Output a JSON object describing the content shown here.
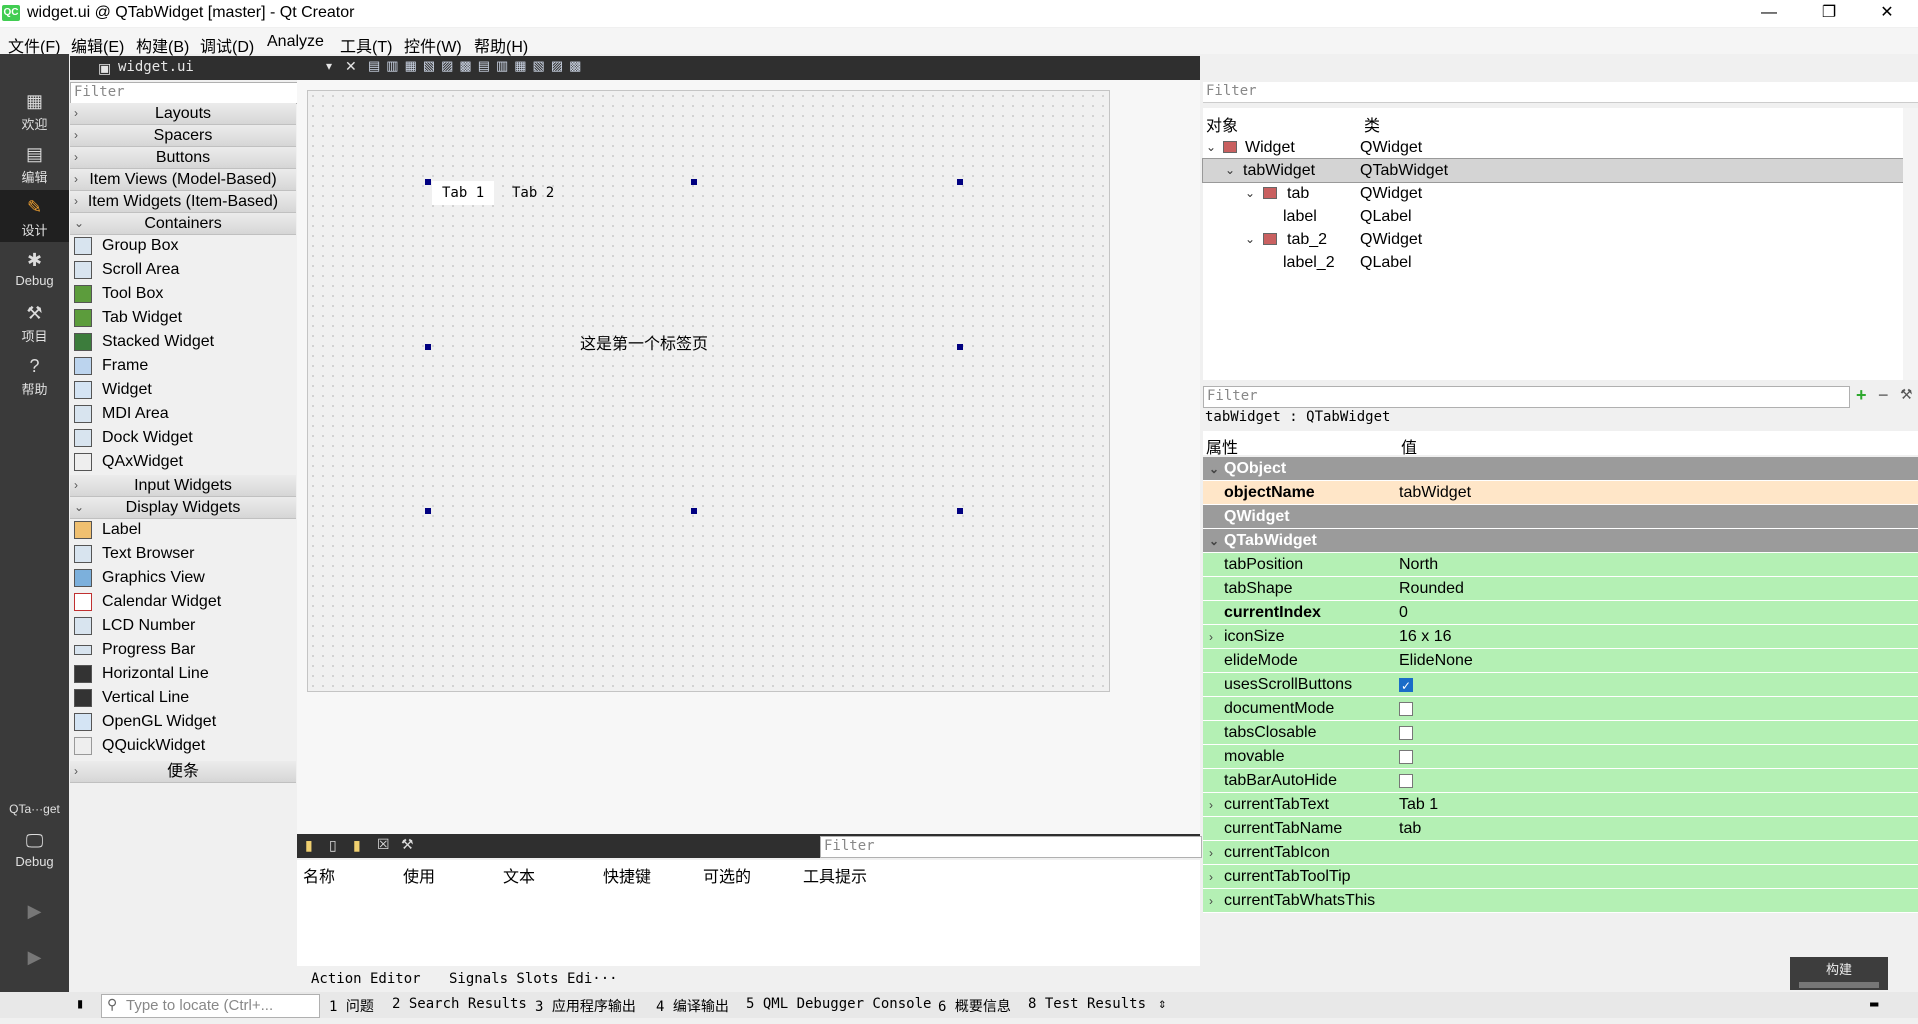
{
  "window": {
    "title": "widget.ui @ QTabWidget [master] - Qt Creator",
    "minimize": "—",
    "restore": "❐",
    "close": "✕"
  },
  "menu": [
    "文件(F)",
    "编辑(E)",
    "构建(B)",
    "调试(D)",
    "Analyze",
    "工具(T)",
    "控件(W)",
    "帮助(H)"
  ],
  "modes": [
    {
      "label": "欢迎",
      "icon": "grid-icon"
    },
    {
      "label": "编辑",
      "icon": "edit-doc-icon"
    },
    {
      "label": "设计",
      "icon": "pencil-icon"
    },
    {
      "label": "Debug",
      "icon": "bug-icon"
    },
    {
      "label": "项目",
      "icon": "wrench-icon"
    },
    {
      "label": "帮助",
      "icon": "help-icon"
    }
  ],
  "kit": {
    "label": "QTa···get",
    "mode": "Debug"
  },
  "editor": {
    "file_tab": "widget.ui"
  },
  "widget_box": {
    "filter_placeholder": "Filter",
    "categories_top": [
      "Layouts",
      "Spacers",
      "Buttons",
      "Item Views (Model-Based)",
      "Item Widgets (Item-Based)",
      "Containers"
    ],
    "containers": [
      "Group Box",
      "Scroll Area",
      "Tool Box",
      "Tab Widget",
      "Stacked Widget",
      "Frame",
      "Widget",
      "MDI Area",
      "Dock Widget",
      "QAxWidget"
    ],
    "mid_categories": [
      "Input Widgets",
      "Display Widgets"
    ],
    "display": [
      "Label",
      "Text Browser",
      "Graphics View",
      "Calendar Widget",
      "LCD Number",
      "Progress Bar",
      "Horizontal Line",
      "Vertical Line",
      "OpenGL Widget",
      "QQuickWidget"
    ],
    "last_category": "便条"
  },
  "form": {
    "tabs": [
      "Tab 1",
      "Tab 2"
    ],
    "label_text": "这是第一个标签页"
  },
  "action_editor": {
    "filter_placeholder": "Filter",
    "columns": [
      "名称",
      "使用",
      "文本",
      "快捷键",
      "可选的",
      "工具提示"
    ],
    "tabs": [
      "Action Editor",
      "Signals  Slots Edi···"
    ]
  },
  "object_inspector": {
    "filter_placeholder": "Filter",
    "col_object": "对象",
    "col_class": "类",
    "rows": [
      {
        "object": "Widget",
        "class": "QWidget"
      },
      {
        "object": "tabWidget",
        "class": "QTabWidget"
      },
      {
        "object": "tab",
        "class": "QWidget"
      },
      {
        "object": "label",
        "class": "QLabel"
      },
      {
        "object": "tab_2",
        "class": "QWidget"
      },
      {
        "object": "label_2",
        "class": "QLabel"
      }
    ]
  },
  "property_editor": {
    "filter_placeholder": "Filter",
    "title": "tabWidget : QTabWidget",
    "col_property": "属性",
    "col_value": "值",
    "groups": {
      "qobject": "QObject",
      "qwidget": "QWidget",
      "qtabwidget": "QTabWidget"
    },
    "objectName": {
      "name": "objectName",
      "value": "tabWidget"
    },
    "props": [
      {
        "name": "tabPosition",
        "value": "North"
      },
      {
        "name": "tabShape",
        "value": "Rounded"
      },
      {
        "name": "currentIndex",
        "value": "0"
      },
      {
        "name": "iconSize",
        "value": "16 x 16"
      },
      {
        "name": "elideMode",
        "value": "ElideNone"
      },
      {
        "name": "usesScrollButtons",
        "checked": true
      },
      {
        "name": "documentMode",
        "checked": false
      },
      {
        "name": "tabsClosable",
        "checked": false
      },
      {
        "name": "movable",
        "checked": false
      },
      {
        "name": "tabBarAutoHide",
        "checked": false
      },
      {
        "name": "currentTabText",
        "value": "Tab 1"
      },
      {
        "name": "currentTabName",
        "value": "tab"
      },
      {
        "name": "currentTabIcon",
        "value": ""
      },
      {
        "name": "currentTabToolTip",
        "value": ""
      },
      {
        "name": "currentTabWhatsThis",
        "value": ""
      }
    ]
  },
  "build_popup": "构建",
  "status": {
    "locate_placeholder": "Type to locate (Ctrl+...",
    "items": [
      "1 问题",
      "2 Search Results",
      "3 应用程序输出",
      "4 编译输出",
      "5 QML Debugger Console",
      "6 概要信息",
      "8 Test Results"
    ]
  },
  "colors": {
    "accent": "#41cd52",
    "group_bg": "#9b9b9b",
    "qobject_row": "#ffe6c8",
    "qtabwidget_row": "#b4f0b4",
    "selection": "#000080"
  }
}
